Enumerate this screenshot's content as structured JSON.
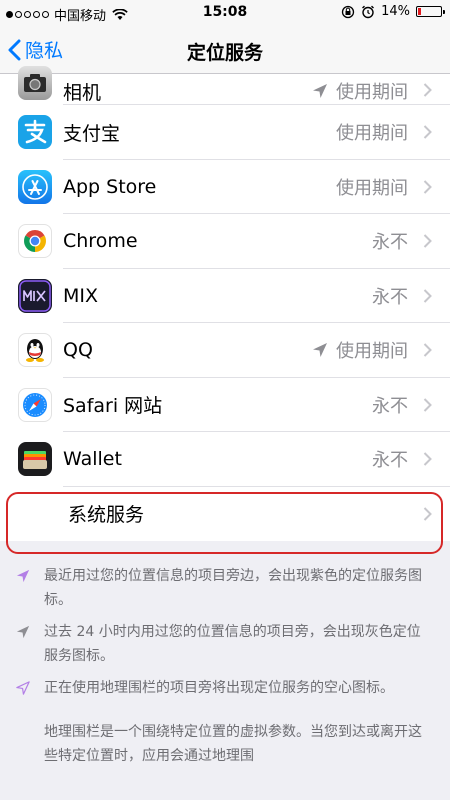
{
  "status_bar": {
    "carrier": "中国移动",
    "time": "15:08",
    "battery": "14%",
    "battery_level": 0.14
  },
  "nav": {
    "back_label": "隐私",
    "title": "定位服务"
  },
  "apps": [
    {
      "name": "相机",
      "value": "使用期间",
      "arrow": true,
      "icon": "camera-icon"
    },
    {
      "name": "支付宝",
      "value": "使用期间",
      "arrow": false,
      "icon": "alipay-icon"
    },
    {
      "name": "App Store",
      "value": "使用期间",
      "arrow": false,
      "icon": "app-store-icon"
    },
    {
      "name": "Chrome",
      "value": "永不",
      "arrow": false,
      "icon": "chrome-icon"
    },
    {
      "name": "MIX",
      "value": "永不",
      "arrow": false,
      "icon": "mix-icon"
    },
    {
      "name": "QQ",
      "value": "使用期间",
      "arrow": true,
      "icon": "qq-icon"
    },
    {
      "name": "Safari 网站",
      "value": "永不",
      "arrow": false,
      "icon": "safari-icon"
    },
    {
      "name": "Wallet",
      "value": "永不",
      "arrow": false,
      "icon": "wallet-icon"
    }
  ],
  "system_services": {
    "label": "系统服务"
  },
  "footer": {
    "note_purple": "最近用过您的位置信息的项目旁边，会出现紫色的定位服务图标。",
    "note_gray": "过去 24 小时内用过您的位置信息的项目旁，会出现灰色定位服务图标。",
    "note_outline": "正在使用地理围栏的项目旁将出现定位服务的空心图标。",
    "geofence_text": "地理围栏是一个围绕特定位置的虚拟参数。当您到达或离开这些特定位置时，应用会通过地理围"
  },
  "colors": {
    "accent": "#007aff",
    "purple_arrow": "#b37fe6",
    "gray_arrow": "#8e8e93",
    "highlight": "#d62828"
  }
}
